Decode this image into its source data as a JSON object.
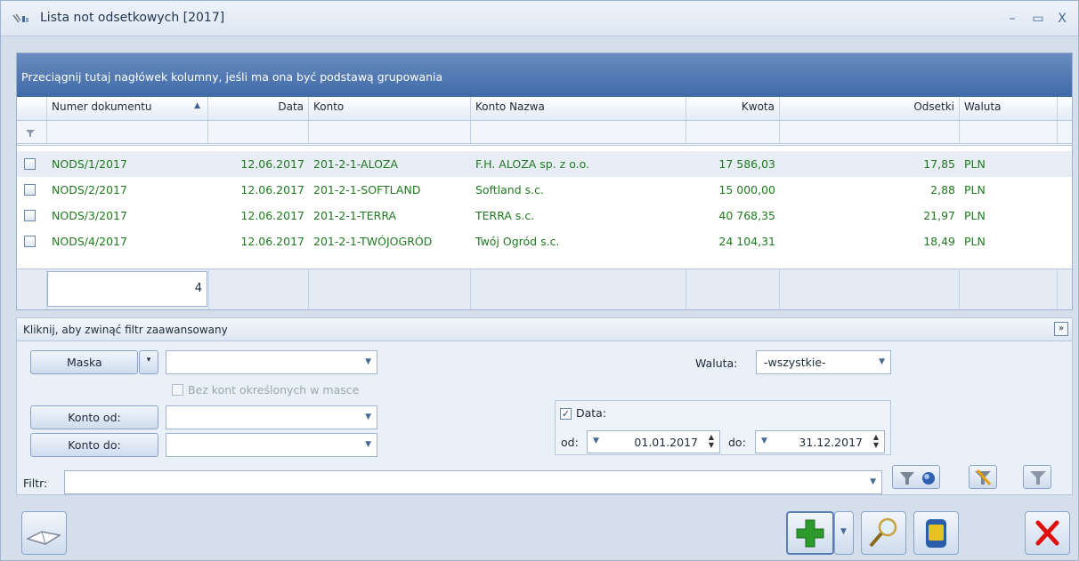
{
  "window": {
    "title": "Lista not odsetkowych [2017]",
    "controls": {
      "minimize": "–",
      "maximize": "▭",
      "close": "X"
    }
  },
  "grid": {
    "group_hint": "Przeciągnij tutaj nagłówek kolumny, jeśli ma ona być podstawą grupowania",
    "columns": {
      "numer": "Numer dokumentu",
      "sort_indicator": "▲",
      "data": "Data",
      "konto": "Konto",
      "konto_nazwa": "Konto Nazwa",
      "kwota": "Kwota",
      "odsetki": "Odsetki",
      "waluta": "Waluta"
    },
    "rows": [
      {
        "numer": "NODS/1/2017",
        "data": "12.06.2017",
        "konto": "201-2-1-ALOZA",
        "nazwa": "F.H. ALOZA sp. z o.o.",
        "kwota": "17 586,03",
        "odsetki": "17,85",
        "waluta": "PLN"
      },
      {
        "numer": "NODS/2/2017",
        "data": "12.06.2017",
        "konto": "201-2-1-SOFTLAND",
        "nazwa": "Softland s.c.",
        "kwota": "15 000,00",
        "odsetki": "2,88",
        "waluta": "PLN"
      },
      {
        "numer": "NODS/3/2017",
        "data": "12.06.2017",
        "konto": "201-2-1-TERRA",
        "nazwa": "TERRA s.c.",
        "kwota": "40 768,35",
        "odsetki": "21,97",
        "waluta": "PLN"
      },
      {
        "numer": "NODS/4/2017",
        "data": "12.06.2017",
        "konto": "201-2-1-TWÓJOGRÓD",
        "nazwa": "Twój Ogród s.c.",
        "kwota": "24 104,31",
        "odsetki": "18,49",
        "waluta": "PLN"
      }
    ],
    "footer_count": "4"
  },
  "filter": {
    "collapse_label": "Kliknij, aby zwinąć filtr zaawansowany",
    "maska_label": "Maska",
    "bez_kont_label": "Bez kont określonych w masce",
    "konto_od_label": "Konto od:",
    "konto_do_label": "Konto do:",
    "waluta_label": "Waluta:",
    "waluta_value": "-wszystkie-",
    "data_label": "Data:",
    "od_label": "od:",
    "od_value": "01.01.2017",
    "do_label": "do:",
    "do_value": "31.12.2017",
    "filtr_label": "Filtr:"
  },
  "colors": {
    "accent": "#3f6aa8",
    "row_text": "#1f7a1f",
    "delete_red": "#e01010",
    "add_green": "#2e9a2e"
  },
  "icons": {
    "app": "app-icon",
    "book": "book-icon",
    "add": "plus-icon",
    "search": "magnifier-icon",
    "delete_bin": "bin-icon",
    "close": "close-icon",
    "filter": "funnel-icon"
  }
}
